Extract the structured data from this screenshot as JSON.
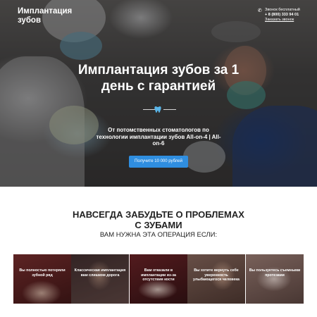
{
  "header": {
    "brand": "Имплантация зубов",
    "contact": {
      "icon": "phone-icon",
      "free_call": "Звонок бесплатный",
      "phone": "+ 8 (800) 333 94 01",
      "callback": "Заказать звонок"
    }
  },
  "hero": {
    "title": "Имплантация зубов за 1 день с гарантией",
    "divider_icon": "tooth-icon",
    "subtitle": "От потомственных стоматологов по технологии имплантации зубов All-on-4 | All-on-6",
    "cta_label": "Получите 10 000 рублей"
  },
  "section": {
    "title": "НАВСЕГДА ЗАБУДЬТЕ О ПРОБЛЕМАХ С ЗУБАМИ",
    "subtitle": "ВАМ НУЖНА ЭТА ОПЕРАЦИЯ ЕСЛИ:",
    "cards": [
      {
        "label": "Вы полностью потеряли зубной ряд"
      },
      {
        "label": "Классическая имплантация вам слишком дорога"
      },
      {
        "label": "Вам отказали в имплантации из-за отсутствия кости"
      },
      {
        "label": "Вы хотите вернуть себе уверенность улыбающегося человека"
      },
      {
        "label": "Вы пользуетесь съемными протезами"
      }
    ]
  },
  "colors": {
    "accent": "#2f8ee0",
    "tooth_icon": "#59b5e8",
    "heading_text": "#222222"
  }
}
